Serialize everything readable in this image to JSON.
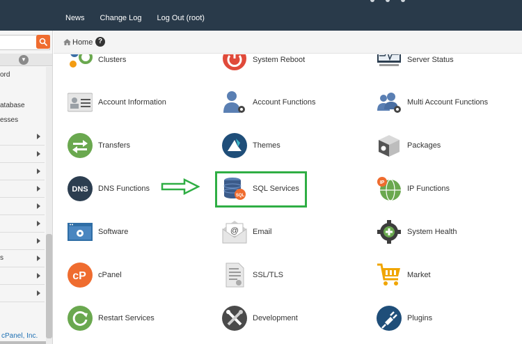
{
  "topnav": {
    "news": "News",
    "changelog": "Change Log",
    "logout": "Log Out (root)"
  },
  "breadcrumb": {
    "home": "Home",
    "help": "?"
  },
  "sidebar": {
    "sub_items": [
      "ord",
      "atabase",
      "esses"
    ],
    "row_partial_label": "s",
    "footer": "cPanel, Inc."
  },
  "tiles": [
    {
      "label": "Clusters",
      "icon": "clusters-icon",
      "color": "#f39c12"
    },
    {
      "label": "System Reboot",
      "icon": "power-icon",
      "color": "#e04a3a"
    },
    {
      "label": "Server Status",
      "icon": "monitor-pulse-icon",
      "color": "#2c3e50"
    },
    {
      "label": "Account Information",
      "icon": "id-card-icon",
      "color": "#9aa0a6"
    },
    {
      "label": "Account Functions",
      "icon": "user-gear-icon",
      "color": "#5a7fb3"
    },
    {
      "label": "Multi Account Functions",
      "icon": "users-gear-icon",
      "color": "#5a7fb3"
    },
    {
      "label": "Transfers",
      "icon": "transfer-arrows-icon",
      "color": "#6aa84f"
    },
    {
      "label": "Themes",
      "icon": "themes-icon",
      "color": "#1f4e79"
    },
    {
      "label": "Packages",
      "icon": "package-box-icon",
      "color": "#555555"
    },
    {
      "label": "DNS Functions",
      "icon": "dns-icon",
      "color": "#2c3e50"
    },
    {
      "label": "SQL Services",
      "icon": "database-sql-icon",
      "color": "#3b5b8a"
    },
    {
      "label": "IP Functions",
      "icon": "globe-ip-icon",
      "color": "#6aa84f"
    },
    {
      "label": "Software",
      "icon": "software-window-icon",
      "color": "#2f6ea6"
    },
    {
      "label": "Email",
      "icon": "email-envelope-icon",
      "color": "#9aa0a6"
    },
    {
      "label": "System Health",
      "icon": "health-gear-icon",
      "color": "#3d3d3d"
    },
    {
      "label": "cPanel",
      "icon": "cpanel-logo-icon",
      "color": "#ef6c2f"
    },
    {
      "label": "SSL/TLS",
      "icon": "certificate-doc-icon",
      "color": "#9aa0a6"
    },
    {
      "label": "Market",
      "icon": "shopping-cart-icon",
      "color": "#f0a500"
    },
    {
      "label": "Restart Services",
      "icon": "restart-circle-icon",
      "color": "#6aa84f"
    },
    {
      "label": "Development",
      "icon": "tools-icon",
      "color": "#4a4a4a"
    },
    {
      "label": "Plugins",
      "icon": "plug-icon",
      "color": "#1f4e79"
    }
  ],
  "colors": {
    "topbar": "#293a4a",
    "highlight": "#2fae44",
    "search_button": "#ef6c2f"
  }
}
